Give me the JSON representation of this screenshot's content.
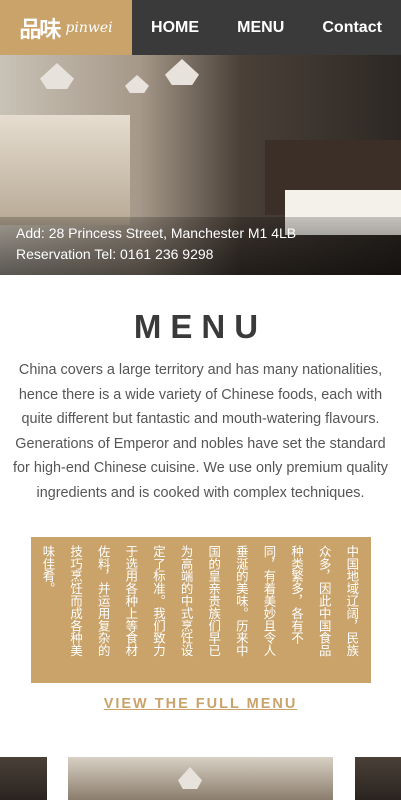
{
  "header": {
    "logo_cn": "品味",
    "logo_en": "pinwei",
    "nav": [
      "HOME",
      "MENU",
      "Contact"
    ]
  },
  "hero": {
    "address": "Add: 28 Princess Street, Manchester M1 4LB",
    "tel": "Reservation Tel: 0161 236 9298"
  },
  "menu": {
    "title": "MENU",
    "intro": "China covers a large territory and has many nationalities, hence there is a wide variety of Chinese foods, each with quite different but fantastic and mouth-watering flavours. Generations of Emperor and nobles have set the standard for high-end Chinese cuisine. We use only premium quality ingredients and is cooked with complex techniques.",
    "cn_columns": [
      "中国地域辽阔，民族",
      "众多，因此中国食品",
      "种类繁多，各有不",
      "同，有着美妙且令人",
      "垂涎的美味。历来中",
      "国的皇亲贵族们早已",
      "为高端的中式烹饪设",
      "定了标准。我们致力",
      "于选用各种上等食材",
      "佐料，并运用复杂的",
      "技巧烹饪而成各种美",
      "味佳肴。"
    ],
    "full_menu_link": "VIEW THE FULL MENU"
  }
}
